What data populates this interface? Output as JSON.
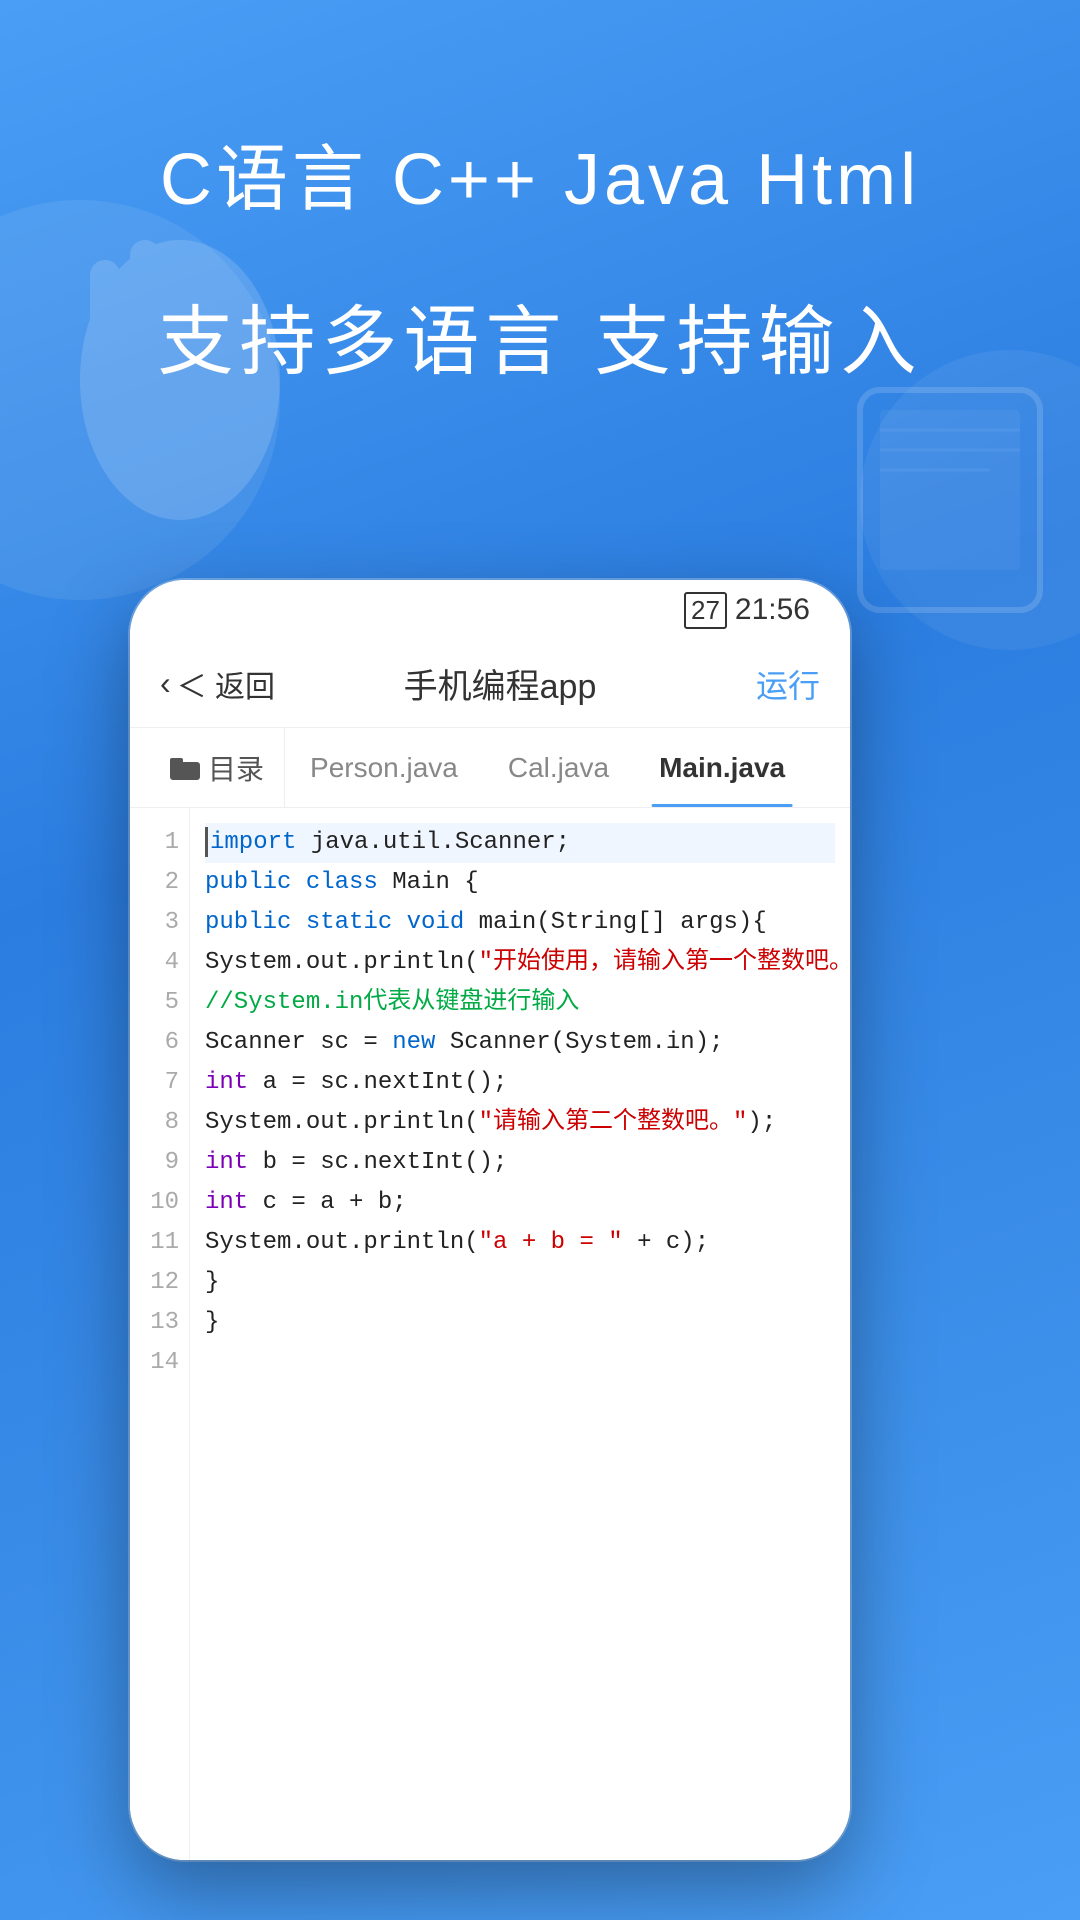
{
  "background": {
    "gradient_start": "#4a9ef5",
    "gradient_end": "#2b7de0"
  },
  "hero": {
    "title": "C语言  C++  Java  Html",
    "subtitle": "支持多语言  支持输入"
  },
  "phone": {
    "status_bar": {
      "battery": "27",
      "time": "21:56"
    },
    "nav": {
      "back_label": "＜ 返回",
      "title": "手机编程app",
      "run_label": "运行"
    },
    "tabs": [
      {
        "label": "目录",
        "active": false,
        "folder": true
      },
      {
        "label": "Person.java",
        "active": false
      },
      {
        "label": "Cal.java",
        "active": false
      },
      {
        "label": "Main.java",
        "active": true
      }
    ],
    "code_lines": [
      {
        "num": "1",
        "tokens": [
          {
            "text": "import",
            "cls": "kw-blue"
          },
          {
            "text": " java.util.Scanner;",
            "cls": "kw-black"
          }
        ],
        "cursor": true
      },
      {
        "num": "2",
        "tokens": [
          {
            "text": "public",
            "cls": "kw-blue"
          },
          {
            "text": " ",
            "cls": "kw-black"
          },
          {
            "text": "class",
            "cls": "kw-blue"
          },
          {
            "text": " Main {",
            "cls": "kw-black"
          }
        ]
      },
      {
        "num": "3",
        "tokens": [
          {
            "text": "  public",
            "cls": "kw-blue"
          },
          {
            "text": " ",
            "cls": "kw-black"
          },
          {
            "text": "static",
            "cls": "kw-blue"
          },
          {
            "text": " ",
            "cls": "kw-black"
          },
          {
            "text": "void",
            "cls": "kw-blue"
          },
          {
            "text": " main(String[] args){",
            "cls": "kw-black"
          }
        ]
      },
      {
        "num": "4",
        "tokens": [
          {
            "text": "    System.out.println(",
            "cls": "kw-black"
          },
          {
            "text": "\"开始使用，请输入第一个整数吧。\"",
            "cls": "kw-red"
          },
          {
            "text": ");",
            "cls": "kw-black"
          }
        ]
      },
      {
        "num": "5",
        "tokens": [
          {
            "text": "    //System.in代表从键盘进行输入",
            "cls": "kw-comment"
          }
        ]
      },
      {
        "num": "6",
        "tokens": [
          {
            "text": "    Scanner sc = ",
            "cls": "kw-black"
          },
          {
            "text": "new",
            "cls": "kw-blue"
          },
          {
            "text": " Scanner(System.in);",
            "cls": "kw-black"
          }
        ]
      },
      {
        "num": "7",
        "tokens": [
          {
            "text": "    ",
            "cls": "kw-black"
          },
          {
            "text": "int",
            "cls": "kw-purple"
          },
          {
            "text": " a = sc.nextInt();",
            "cls": "kw-black"
          }
        ]
      },
      {
        "num": "8",
        "tokens": [
          {
            "text": "    System.out.println(",
            "cls": "kw-black"
          },
          {
            "text": "\"请输入第二个整数吧。\"",
            "cls": "kw-red"
          },
          {
            "text": ");",
            "cls": "kw-black"
          }
        ]
      },
      {
        "num": "9",
        "tokens": [
          {
            "text": "    ",
            "cls": "kw-black"
          },
          {
            "text": "int",
            "cls": "kw-purple"
          },
          {
            "text": " b = sc.nextInt();",
            "cls": "kw-black"
          }
        ]
      },
      {
        "num": "10",
        "tokens": [
          {
            "text": "    ",
            "cls": "kw-black"
          },
          {
            "text": "int",
            "cls": "kw-purple"
          },
          {
            "text": " c = a + b;",
            "cls": "kw-black"
          }
        ]
      },
      {
        "num": "11",
        "tokens": [
          {
            "text": "    System.out.println(",
            "cls": "kw-black"
          },
          {
            "text": "\"a + b = \"",
            "cls": "kw-red"
          },
          {
            "text": " + c);",
            "cls": "kw-black"
          }
        ]
      },
      {
        "num": "12",
        "tokens": [
          {
            "text": "  }",
            "cls": "kw-black"
          }
        ]
      },
      {
        "num": "13",
        "tokens": [
          {
            "text": "}",
            "cls": "kw-black"
          }
        ]
      },
      {
        "num": "14",
        "tokens": []
      }
    ]
  }
}
